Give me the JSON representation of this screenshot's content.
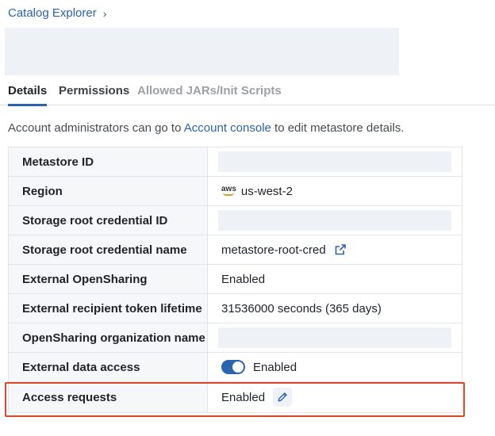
{
  "breadcrumb": {
    "root": "Catalog Explorer",
    "chevron": "›"
  },
  "tabs": [
    {
      "label": "Details",
      "state": "active"
    },
    {
      "label": "Permissions",
      "state": "normal"
    },
    {
      "label": "Allowed JARs/Init Scripts",
      "state": "disabled"
    }
  ],
  "info": {
    "prefix": "Account administrators can go to ",
    "link": "Account console",
    "suffix": " to edit metastore details."
  },
  "details": {
    "metastore_id": {
      "label": "Metastore ID"
    },
    "region": {
      "label": "Region",
      "value": "us-west-2",
      "logo_text": "aws",
      "icon": "aws-logo-icon"
    },
    "storage_root_credential_id": {
      "label": "Storage root credential ID"
    },
    "storage_root_credential_name": {
      "label": "Storage root credential name",
      "value": "metastore-root-cred",
      "icon": "external-link-icon"
    },
    "external_opensharing": {
      "label": "External OpenSharing",
      "value": "Enabled"
    },
    "token_lifetime": {
      "label": "External recipient token lifetime",
      "value": "31536000 seconds (365 days)"
    },
    "org_name": {
      "label": "OpenSharing organization name"
    },
    "external_data_access": {
      "label": "External data access",
      "value": "Enabled",
      "toggle_on": true
    },
    "access_requests": {
      "label": "Access requests",
      "value": "Enabled",
      "icon": "pencil-icon"
    }
  },
  "colors": {
    "accent": "#2a63b0",
    "placeholder": "#eef2f6",
    "highlight": "#d9482b",
    "label_bg": "#f6f7f9"
  }
}
